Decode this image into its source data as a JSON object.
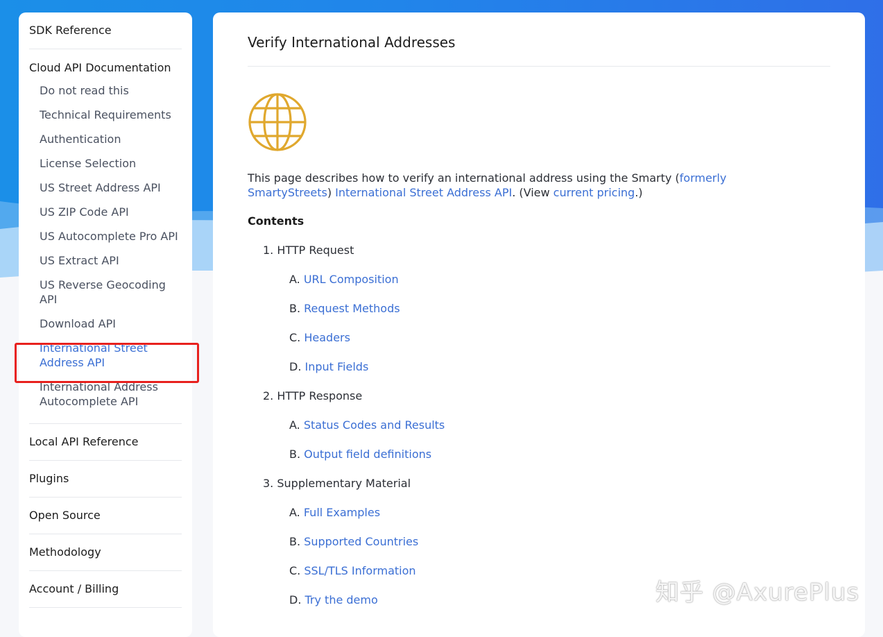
{
  "sidebar": {
    "sdk_reference": "SDK Reference",
    "cloud_api_title": "Cloud API Documentation",
    "cloud_items": [
      "Do not read this",
      "Technical Requirements",
      "Authentication",
      "License Selection",
      "US Street Address API",
      "US ZIP Code API",
      "US Autocomplete Pro API",
      "US Extract API",
      "US Reverse Geocoding API",
      "Download API",
      "International Street Address API",
      "International Address Autocomplete API"
    ],
    "active_item": "International Street Address API",
    "sections": [
      "Local API Reference",
      "Plugins",
      "Open Source",
      "Methodology",
      "Account / Billing"
    ]
  },
  "main": {
    "title": "Verify International Addresses",
    "icon": "globe-icon",
    "intro": {
      "text1": "This page describes how to verify an international address using the Smarty (",
      "link_formerly": "formerly SmartyStreets",
      "text2": ")",
      "link_api": "International Street Address API",
      "text3": ". (View ",
      "link_pricing": "current pricing",
      "text4": ".)"
    },
    "contents_heading": "Contents",
    "toc": [
      {
        "num": "1.",
        "label": "HTTP Request",
        "children": [
          {
            "letter": "A.",
            "label": "URL Composition"
          },
          {
            "letter": "B.",
            "label": "Request Methods"
          },
          {
            "letter": "C.",
            "label": "Headers"
          },
          {
            "letter": "D.",
            "label": "Input Fields"
          }
        ]
      },
      {
        "num": "2.",
        "label": "HTTP Response",
        "children": [
          {
            "letter": "A.",
            "label": "Status Codes and Results"
          },
          {
            "letter": "B.",
            "label": "Output field definitions"
          }
        ]
      },
      {
        "num": "3.",
        "label": "Supplementary Material",
        "children": [
          {
            "letter": "A.",
            "label": "Full Examples"
          },
          {
            "letter": "B.",
            "label": "Supported Countries"
          },
          {
            "letter": "C.",
            "label": "SSL/TLS Information"
          },
          {
            "letter": "D.",
            "label": "Try the demo"
          }
        ]
      }
    ]
  },
  "watermark": "知乎 @AxurePlus",
  "colors": {
    "link": "#3b6fd4",
    "highlight": "#e8211e",
    "globe": "#e0a82e",
    "banner": "#2185ea"
  }
}
